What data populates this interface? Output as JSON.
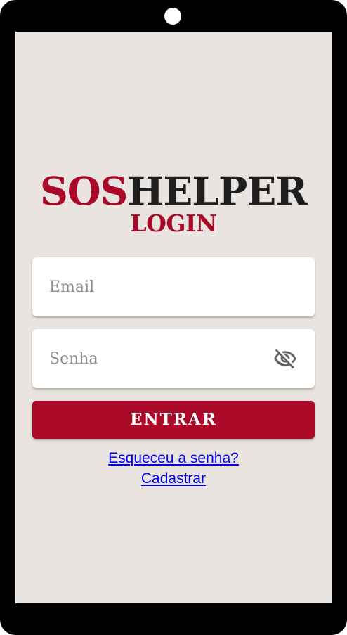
{
  "app": {
    "logo_primary": "SOS",
    "logo_secondary": "HELPER",
    "subtitle": "LOGIN"
  },
  "form": {
    "email_placeholder": "Email",
    "email_value": "",
    "password_placeholder": "Senha",
    "password_value": "",
    "password_toggle_icon": "eye-off-icon",
    "submit_label": "ENTRAR"
  },
  "links": {
    "forgot_password": "Esqueceu a senha?",
    "register": "Cadastrar"
  },
  "colors": {
    "brand_red": "#aa0a28",
    "screen_background": "#e9e4df",
    "logo_dark": "#1f1f1f",
    "link_blue": "#0000ee"
  }
}
